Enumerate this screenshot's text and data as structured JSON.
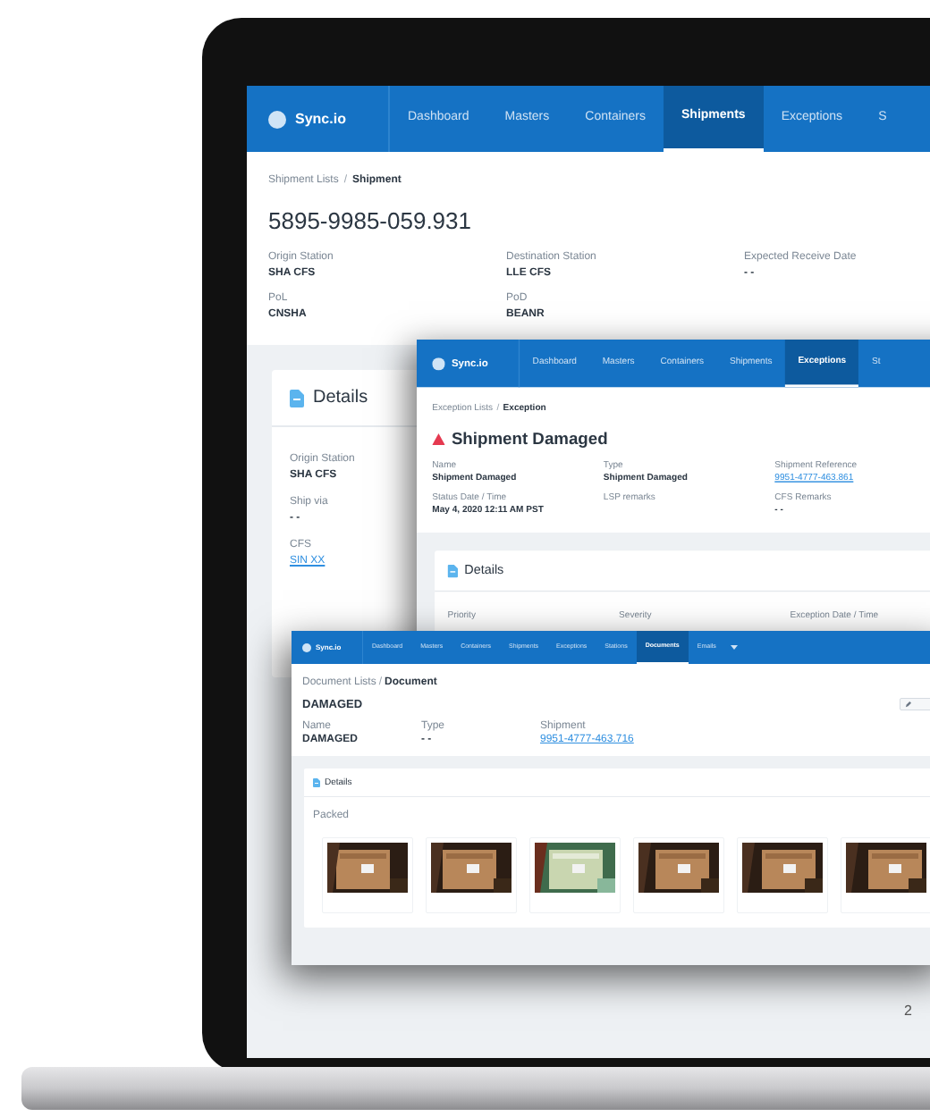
{
  "windows": [
    {
      "kind": "shipment",
      "nav": {
        "brand": "Sync.io",
        "tabs": [
          {
            "label": "Dashboard",
            "selected": false
          },
          {
            "label": "Masters",
            "selected": false
          },
          {
            "label": "Containers",
            "selected": false
          },
          {
            "label": "Shipments",
            "selected": true
          },
          {
            "label": "Exceptions",
            "selected": false
          },
          {
            "label": "S",
            "selected": false
          }
        ]
      },
      "breadcrumb": {
        "parent": "Shipment Lists",
        "separator": "/",
        "current": "Shipment"
      },
      "title": "5895-9985-059.931",
      "fields": [
        {
          "label": "Origin Station",
          "value": "SHA CFS"
        },
        {
          "label": "Destination Station",
          "value": "LLE CFS"
        },
        {
          "label": "Expected Receive Date",
          "value": "- -"
        },
        {
          "label": "PoL",
          "value": "CNSHA"
        },
        {
          "label": "PoD",
          "value": "BEANR"
        }
      ],
      "card": {
        "kind": "list",
        "title": "Details",
        "fields": [
          {
            "label": "Origin Station",
            "value": "SHA CFS"
          },
          {
            "label": "Ship via",
            "value": "- -"
          },
          {
            "label": "CFS",
            "value": "SIN XX",
            "link": true
          }
        ]
      },
      "footer": "2"
    },
    {
      "kind": "exception",
      "nav": {
        "brand": "Sync.io",
        "tabs": [
          {
            "label": "Dashboard",
            "selected": false
          },
          {
            "label": "Masters",
            "selected": false
          },
          {
            "label": "Containers",
            "selected": false
          },
          {
            "label": "Shipments",
            "selected": false
          },
          {
            "label": "Exceptions",
            "selected": true
          },
          {
            "label": "St",
            "selected": false
          }
        ]
      },
      "breadcrumb": {
        "parent": "Exception Lists",
        "separator": "/",
        "current": "Exception"
      },
      "title": "Shipment Damaged",
      "alert": true,
      "fields": [
        {
          "label": "Name",
          "value": "Shipment Damaged"
        },
        {
          "label": "Type",
          "value": "Shipment Damaged"
        },
        {
          "label": "Shipment Reference",
          "value": "9951-4777-463.861",
          "link": true
        },
        {
          "label": "Status Date / Time",
          "value": "May 4, 2020 12:11 AM PST"
        },
        {
          "label": "LSP remarks"
        },
        {
          "label": "CFS Remarks",
          "value": "- -"
        }
      ],
      "card": {
        "kind": "row",
        "title": "Details",
        "fields": [
          {
            "label": "Priority"
          },
          {
            "label": "Severity"
          },
          {
            "label": "Exception Date / Time"
          }
        ]
      }
    },
    {
      "kind": "document",
      "nav": {
        "brand": "Sync.io",
        "more": true,
        "tabs": [
          {
            "label": "Dashboard",
            "selected": false
          },
          {
            "label": "Masters",
            "selected": false
          },
          {
            "label": "Containers",
            "selected": false
          },
          {
            "label": "Shipments",
            "selected": false
          },
          {
            "label": "Exceptions",
            "selected": false
          },
          {
            "label": "Stations",
            "selected": false
          },
          {
            "label": "Documents",
            "selected": true
          },
          {
            "label": "Emails",
            "selected": false
          }
        ]
      },
      "breadcrumb": {
        "parent": "Document Lists",
        "separator": "/",
        "current": "Document"
      },
      "title": "DAMAGED",
      "fields": [
        {
          "label": "Name",
          "value": "DAMAGED"
        },
        {
          "label": "Type",
          "value": "- -"
        },
        {
          "label": "Shipment",
          "value": "9951-4777-463.716",
          "link": true
        }
      ],
      "card": {
        "kind": "gallery",
        "title": "Details",
        "caption": "Packed"
      }
    }
  ]
}
